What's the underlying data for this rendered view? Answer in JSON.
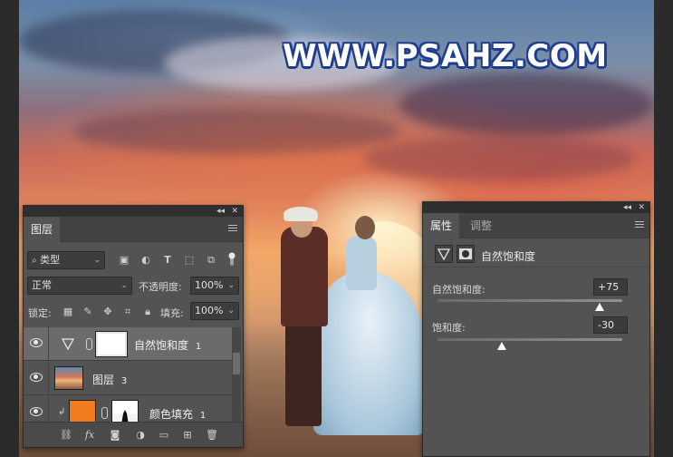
{
  "watermark": "WWW.PSAHZ.COM",
  "layers_panel": {
    "tab_label": "图层",
    "filter": {
      "label": "类型"
    },
    "blend_mode": "正常",
    "opacity_label": "不透明度:",
    "opacity_value": "100%",
    "lock_label": "锁定:",
    "fill_label": "填充:",
    "fill_value": "100%",
    "layers": [
      {
        "name": "自然饱和度",
        "suffix": "1",
        "kind": "adjustment",
        "selected": true
      },
      {
        "name": "图层",
        "suffix": "3",
        "kind": "image",
        "selected": false
      },
      {
        "name": "颜色填充",
        "suffix": "1",
        "kind": "fill",
        "fill_color": "#f07c1e",
        "selected": false
      }
    ],
    "bottom_icons": [
      "link-icon",
      "fx-icon",
      "mask-icon",
      "adjustment-icon",
      "folder-icon",
      "new-layer-icon",
      "trash-icon"
    ],
    "fx_label": "fx"
  },
  "properties_panel": {
    "tabs": [
      {
        "label": "属性",
        "active": true
      },
      {
        "label": "调整",
        "active": false
      }
    ],
    "adjustment_title": "自然饱和度",
    "vibrance": {
      "label": "自然饱和度:",
      "value": "+75",
      "level": 0.875
    },
    "saturation": {
      "label": "饱和度:",
      "value": "-30",
      "level": 0.35
    }
  },
  "panel_controls": {
    "collapse": "◂◂",
    "close": "✕"
  }
}
